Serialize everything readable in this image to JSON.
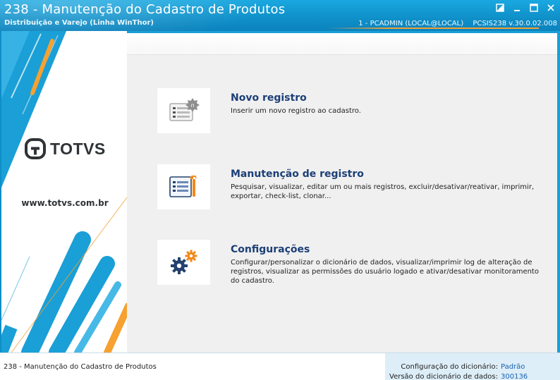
{
  "window": {
    "title": "238 - Manutenção do Cadastro de Produtos",
    "subtitle": "Distribuição e Varejo (Linha WinThor)",
    "session_user": "1 - PCADMIN (LOCAL@LOCAL)",
    "session_version": "PCSIS238  v.30.0.02.008"
  },
  "banner": {
    "logo_text": "TOTVS",
    "website": "www.totvs.com.br",
    "colors": {
      "blue": "#1a9fd6",
      "orange": "#f6a130",
      "dark": "#2f3336"
    }
  },
  "options": [
    {
      "icon": "new-record-form-icon",
      "title": "Novo registro",
      "description": "Inserir um novo registro ao cadastro."
    },
    {
      "icon": "maintenance-form-wrench-icon",
      "title": "Manutenção de registro",
      "description": "Pesquisar, visualizar, editar um ou mais registros, excluir/desativar/reativar, imprimir, exportar, check-list,  clonar..."
    },
    {
      "icon": "settings-gears-icon",
      "title": "Configurações",
      "description": "Configurar/personalizar o dicionário de dados, visualizar/imprimir log de alteração de registros, visualizar as permissões do usuário logado e ativar/desativar monitoramento do cadastro."
    }
  ],
  "statusbar": {
    "title": "238 - Manutenção do Cadastro de Produtos",
    "config_label": "Configuração do dicionário:",
    "config_value": "Padrão",
    "version_label": "Versão do dicionário de dados:",
    "version_value": "300136"
  }
}
